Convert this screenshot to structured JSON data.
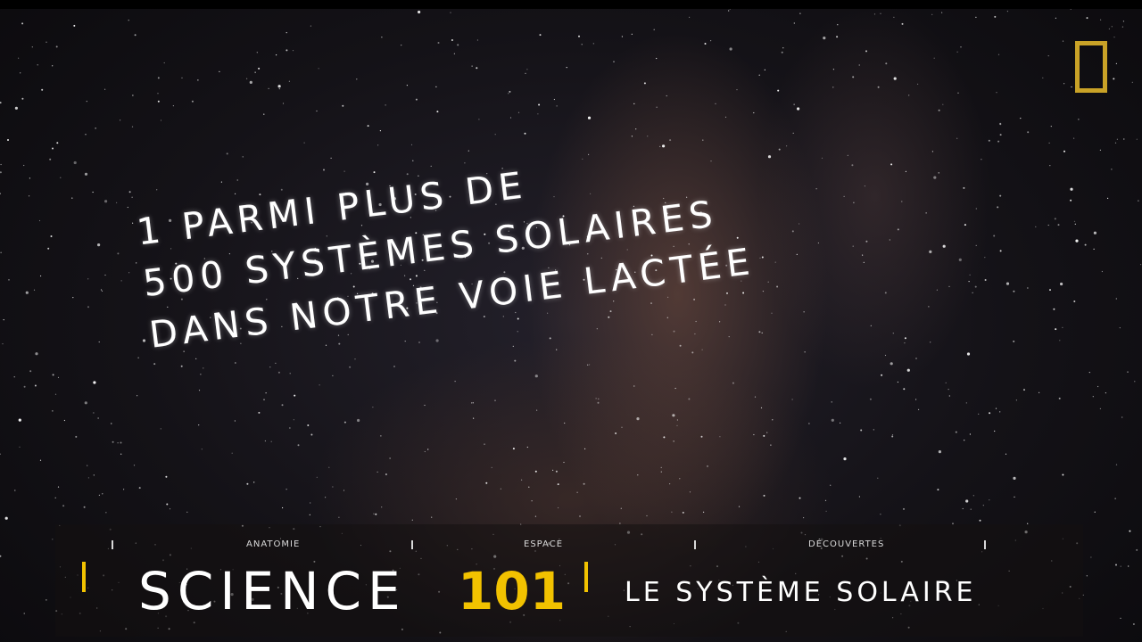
{
  "headline": {
    "line1": "1 PARMI PLUS DE",
    "line2": "500 SYSTÈMES SOLAIRES",
    "line3": "DANS NOTRE VOIE LACTÉE"
  },
  "lower_third": {
    "categories": [
      "ANATOMIE",
      "ESPACE",
      "DÉCOUVERTES"
    ],
    "title": "SCIENCE",
    "number": "101",
    "subject": "LE SYSTÈME SOLAIRE"
  },
  "logo": {
    "icon": "national-geographic-yellow-rectangle-icon",
    "color": "#c9a227"
  },
  "colors": {
    "accent": "#f2c200",
    "text": "#ffffff"
  }
}
